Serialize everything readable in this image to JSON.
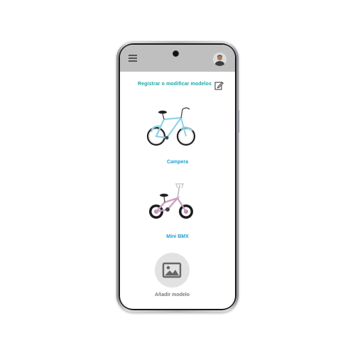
{
  "app": {
    "header": {
      "link_label": "Registrar o modificar modelos",
      "menu_icon": "hamburger-menu-icon",
      "edit_icon": "edit-pencil-icon",
      "avatar": "user-avatar"
    },
    "models": [
      {
        "name": "Campera",
        "icon": "cruiser-bike-image"
      },
      {
        "name": "Mini BMX",
        "icon": "bmx-bike-image"
      }
    ],
    "add_model": {
      "label": "Añadir modelo",
      "icon": "image-placeholder-icon"
    },
    "colors": {
      "accent_teal": "#1aa7a7",
      "accent_blue": "#1a9fd6",
      "topbar": "#bfbfbf"
    }
  }
}
